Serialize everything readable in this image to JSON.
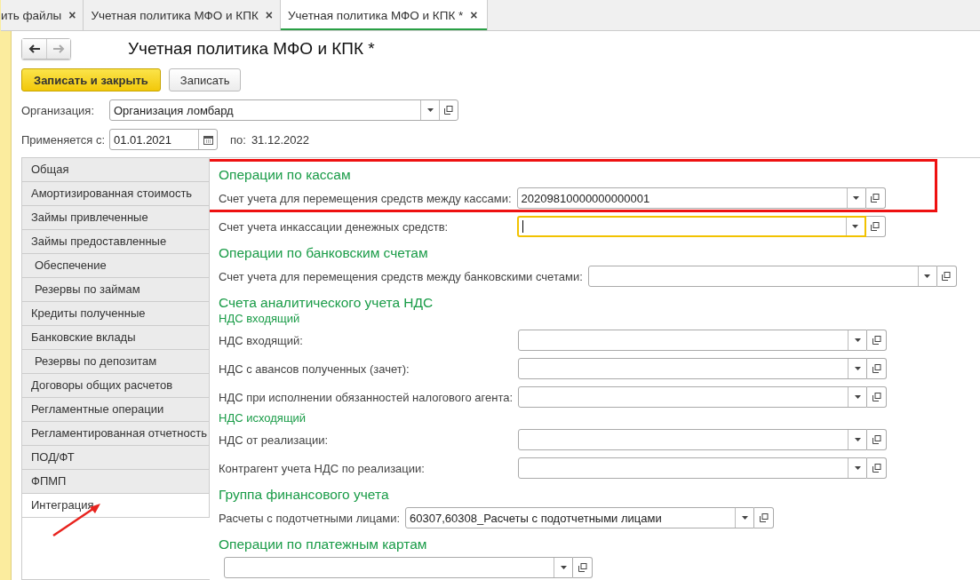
{
  "doc_tabs": [
    {
      "label": "ить файлы",
      "close": "×",
      "selected": false
    },
    {
      "label": "Учетная политика МФО и КПК",
      "close": "×",
      "selected": false
    },
    {
      "label": "Учетная политика МФО и КПК *",
      "close": "×",
      "selected": true
    }
  ],
  "title": "Учетная политика МФО и КПК *",
  "buttons": [
    {
      "label": "Записать и закрыть",
      "kind": "primary"
    },
    {
      "label": "Записать",
      "kind": "normal"
    }
  ],
  "organization": {
    "label": "Организация:",
    "value": "Организация ломбард"
  },
  "period": {
    "label": "Применяется с:",
    "value": "01.01.2021",
    "to_label": "по:",
    "to_value": "31.12.2022"
  },
  "side_tabs": [
    {
      "label": "Общая",
      "indented": false,
      "selected": false
    },
    {
      "label": "Амортизированная стоимость",
      "indented": false,
      "selected": false
    },
    {
      "label": "Займы привлеченные",
      "indented": false,
      "selected": false
    },
    {
      "label": "Займы предоставленные",
      "indented": false,
      "selected": false
    },
    {
      "label": "Обеспечение",
      "indented": true,
      "selected": false
    },
    {
      "label": "Резервы по займам",
      "indented": true,
      "selected": false
    },
    {
      "label": "Кредиты полученные",
      "indented": false,
      "selected": false
    },
    {
      "label": "Банковские вклады",
      "indented": false,
      "selected": false
    },
    {
      "label": "Резервы по депозитам",
      "indented": true,
      "selected": false
    },
    {
      "label": "Договоры общих расчетов",
      "indented": false,
      "selected": false
    },
    {
      "label": "Регламентные операции",
      "indented": false,
      "selected": false
    },
    {
      "label": "Регламентированная отчетность",
      "indented": false,
      "selected": false
    },
    {
      "label": "ПОД/ФТ",
      "indented": false,
      "selected": false
    },
    {
      "label": "ФПМП",
      "indented": false,
      "selected": false
    },
    {
      "label": "Интеграция",
      "indented": false,
      "selected": true
    }
  ],
  "sections": [
    {
      "items": [
        {
          "kind": "heading",
          "text": "Операции по кассам",
          "highlighted": true
        },
        {
          "kind": "field",
          "label": "Счет учета для перемещения средств между кассами:",
          "value": "20209810000000000001",
          "focused": false,
          "highlighted": true
        },
        {
          "kind": "field",
          "label": "Счет учета инкассации денежных средств:",
          "focused": true,
          "highlighted": false
        }
      ]
    },
    {
      "items": [
        {
          "kind": "heading",
          "text": "Операции по банковским счетам",
          "highlighted": false
        },
        {
          "kind": "field",
          "label": "Счет учета для перемещения средств между банковскими счетами:",
          "focused": false,
          "highlighted": false
        }
      ]
    },
    {
      "items": [
        {
          "kind": "heading",
          "text": "Счета аналитического учета НДС",
          "highlighted": false
        },
        {
          "kind": "subheading",
          "text": "НДС входящий",
          "highlighted": false
        },
        {
          "kind": "field",
          "label": "НДС входящий:",
          "focused": false,
          "highlighted": false
        },
        {
          "kind": "field",
          "label": "НДС с авансов полученных (зачет):",
          "focused": false,
          "highlighted": false
        },
        {
          "kind": "field",
          "label": "НДС при исполнении обязанностей налогового агента:",
          "focused": false,
          "highlighted": false
        },
        {
          "kind": "subheading",
          "text": "НДС исходящий",
          "highlighted": false
        },
        {
          "kind": "field",
          "label": "НДС от реализации:",
          "focused": false,
          "highlighted": false
        },
        {
          "kind": "field",
          "label": "Контрагент учета НДС по реализации:",
          "focused": false,
          "highlighted": false
        }
      ]
    },
    {
      "items": [
        {
          "kind": "heading",
          "text": "Группа финансового учета",
          "highlighted": false
        },
        {
          "kind": "field",
          "label": "Расчеты с подотчетными лицами:",
          "value": "60307,60308_Расчеты с подотчетными лицами",
          "focused": false,
          "highlighted": false
        }
      ]
    },
    {
      "items": [
        {
          "kind": "heading",
          "text": "Операции по платежным картам",
          "highlighted": false
        },
        {
          "kind": "field",
          "focused": false,
          "highlighted": false
        }
      ]
    }
  ]
}
